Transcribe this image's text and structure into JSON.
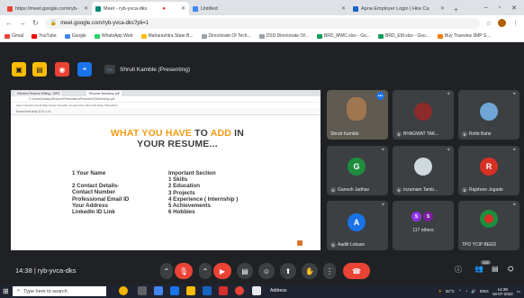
{
  "browser": {
    "tabs": [
      {
        "label": "https://meet.google.com/ryb-",
        "fav": "#ea4335",
        "active": false
      },
      {
        "label": "Meet - ryb-yvca-dks",
        "fav": "#00897b",
        "active": true
      },
      {
        "label": "Untitled",
        "fav": "#4285f4",
        "active": false
      },
      {
        "label": "Apna Employer Login | Hire Ca",
        "fav": "#1565c0",
        "active": false
      }
    ],
    "address": "meet.google.com/ryb-yvca-dks?pli=1",
    "bookmarks": [
      {
        "label": "Gmail",
        "color": "#ea4335"
      },
      {
        "label": "YouTube",
        "color": "#ff0000"
      },
      {
        "label": "Google",
        "color": "#4285f4"
      },
      {
        "label": "WhatsApp Web",
        "color": "#25d366"
      },
      {
        "label": "Maharashtra State B...",
        "color": "#fbbc04"
      },
      {
        "label": "Directorate Of Tech...",
        "color": "#9aa0a6"
      },
      {
        "label": "DSD Directorate Of...",
        "color": "#9aa0a6"
      },
      {
        "label": "BRD_MWC.xlsx - Go...",
        "color": "#0f9d58"
      },
      {
        "label": "BRD_EM.xlsx - Goo...",
        "color": "#0f9d58"
      },
      {
        "label": "Buy Trueview 3MP S...",
        "color": "#f57c00"
      }
    ]
  },
  "meet": {
    "presenter_label": "Shruti Kamble (Presenting)",
    "meeting_code": "14:38  |  ryb-yvca-dks",
    "others_label": "117 others",
    "people_badge": "126"
  },
  "presentation": {
    "inner_tabs": [
      "Effective Resume Writing - WPS",
      "Resume Workshop.pdf"
    ],
    "inner_address": "C:/Users/Desktop/Resume/Presentation/Resume%20Workshop.pdf",
    "inner_bookmarks": "Apps  Contacts  Gmail  Maps  News  Translate  Google Drive  Microsoft Edge  SharePoint",
    "inner_format": "Normal text   Arial   11   B  I  U  A",
    "headline_1_a": "WHAT YOU HAVE",
    "headline_1_b": "TO",
    "headline_1_c": "ADD",
    "headline_1_d": "IN",
    "headline_2": "YOUR RESUME...",
    "left_list": [
      "1 Your Name",
      "",
      "2 Contact Details-",
      "Contact Number",
      "Professional Email ID",
      "Your Address",
      "LinkedIn ID Link"
    ],
    "right_list": [
      "Important  Section",
      "1 Skills",
      "2 Education",
      "3 Projects",
      "4 Experience ( Internship )",
      "5 Achievements",
      "6 Hobbies"
    ]
  },
  "participants": [
    {
      "name": "Shruti Kamble"
    },
    {
      "name": "BHAGWAT TAK..."
    },
    {
      "name": "Rohit Bahir"
    },
    {
      "name": "Ganesh Jadhav",
      "initial": "G",
      "color": "#1e8e3e"
    },
    {
      "name": "Inzamam Tamb..."
    },
    {
      "name": "Rajshree Jogade",
      "initial": "R",
      "color": "#d93025"
    },
    {
      "name": "Aaditi Lokase",
      "initial": "A",
      "color": "#1a73e8"
    },
    {
      "name": "TPO YCIP BEED"
    }
  ],
  "others_initials": [
    "S",
    "S"
  ],
  "taskbar": {
    "search_placeholder": "Type here to search",
    "address_label": "Address",
    "temperature": "32°C",
    "lang": "ENG",
    "time": "14:38",
    "date": "18-07-2022"
  },
  "colors": {
    "meet_bg": "#202124",
    "tile_bg": "#3c4043",
    "end_call": "#ea4335",
    "slide_accent": "#f29b12"
  }
}
